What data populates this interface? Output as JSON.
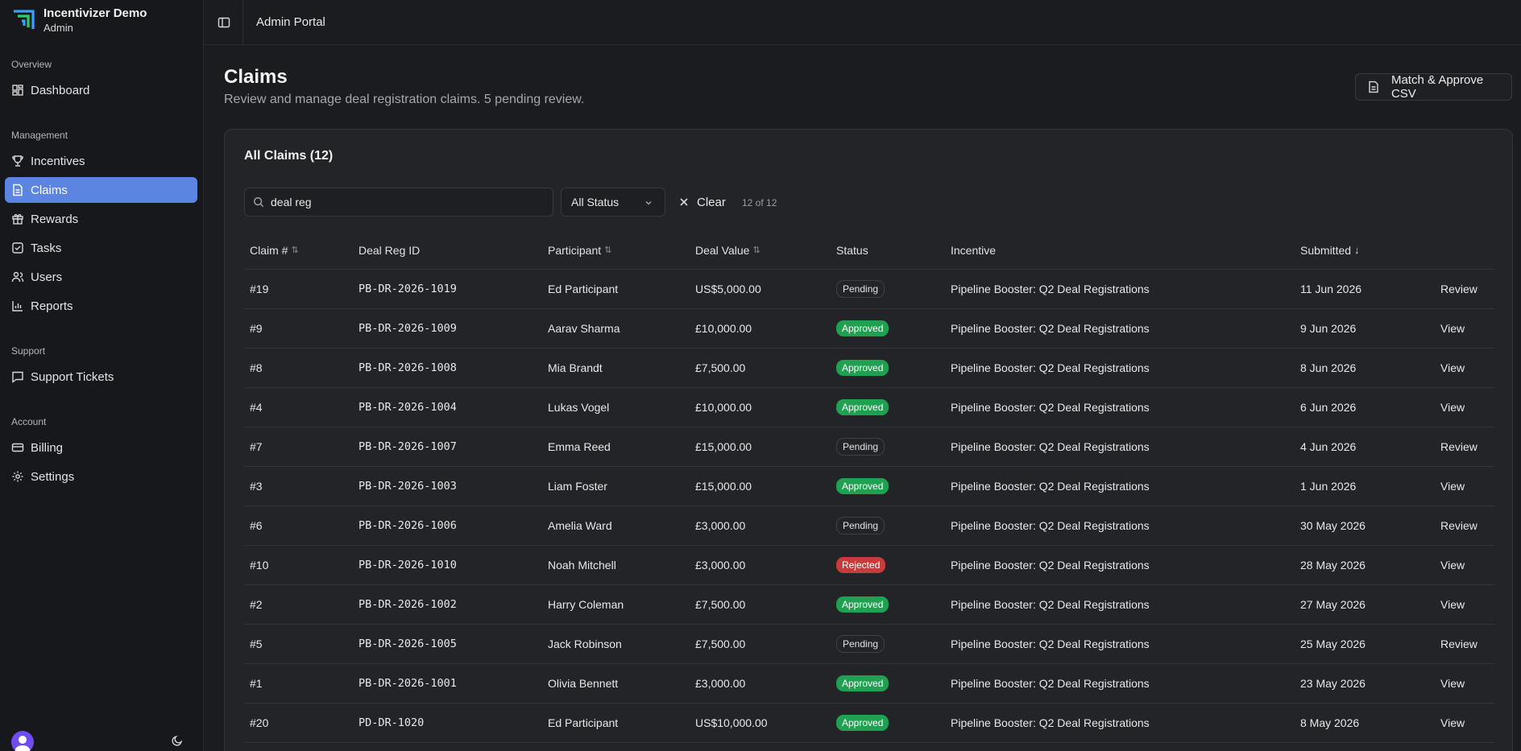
{
  "app": {
    "name": "Incentivizer Demo",
    "role": "Admin"
  },
  "sidebar": {
    "groups": [
      {
        "label": "Overview",
        "items": [
          {
            "label": "Dashboard",
            "icon": "dashboard-icon"
          }
        ]
      },
      {
        "label": "Management",
        "items": [
          {
            "label": "Incentives",
            "icon": "trophy-icon"
          },
          {
            "label": "Claims",
            "icon": "file-icon"
          },
          {
            "label": "Rewards",
            "icon": "gift-icon"
          },
          {
            "label": "Tasks",
            "icon": "checkbox-icon"
          },
          {
            "label": "Users",
            "icon": "users-icon"
          },
          {
            "label": "Reports",
            "icon": "bar-chart-icon"
          }
        ]
      },
      {
        "label": "Support",
        "items": [
          {
            "label": "Support Tickets",
            "icon": "message-icon"
          }
        ]
      },
      {
        "label": "Account",
        "items": [
          {
            "label": "Billing",
            "icon": "credit-card-icon"
          },
          {
            "label": "Settings",
            "icon": "gear-icon"
          }
        ]
      }
    ]
  },
  "topbar": {
    "title": "Admin Portal"
  },
  "page": {
    "title": "Claims",
    "subtitle": "Review and manage deal registration claims. 5 pending review.",
    "action_label": "Match & Approve CSV"
  },
  "card": {
    "title": "All Claims (12)",
    "search_value": "deal reg",
    "status_filter": "All Status",
    "clear_label": "Clear",
    "count_text": "12 of 12"
  },
  "table": {
    "headers": {
      "claim": "Claim #",
      "deal_reg": "Deal Reg ID",
      "participant": "Participant",
      "deal_value": "Deal Value",
      "status": "Status",
      "incentive": "Incentive",
      "submitted": "Submitted"
    },
    "sort_icons": {
      "claim": "⇅",
      "participant": "⇅",
      "deal_value": "⇅",
      "submitted": "↓"
    },
    "rows": [
      {
        "claim": "#19",
        "deal_reg": "PB-DR-2026-1019",
        "participant": "Ed Participant",
        "value": "US$5,000.00",
        "status": "Pending",
        "incentive": "Pipeline Booster: Q2 Deal Registrations",
        "submitted": "11 Jun 2026",
        "action": "Review"
      },
      {
        "claim": "#9",
        "deal_reg": "PB-DR-2026-1009",
        "participant": "Aarav Sharma",
        "value": "£10,000.00",
        "status": "Approved",
        "incentive": "Pipeline Booster: Q2 Deal Registrations",
        "submitted": "9 Jun 2026",
        "action": "View"
      },
      {
        "claim": "#8",
        "deal_reg": "PB-DR-2026-1008",
        "participant": "Mia Brandt",
        "value": "£7,500.00",
        "status": "Approved",
        "incentive": "Pipeline Booster: Q2 Deal Registrations",
        "submitted": "8 Jun 2026",
        "action": "View"
      },
      {
        "claim": "#4",
        "deal_reg": "PB-DR-2026-1004",
        "participant": "Lukas Vogel",
        "value": "£10,000.00",
        "status": "Approved",
        "incentive": "Pipeline Booster: Q2 Deal Registrations",
        "submitted": "6 Jun 2026",
        "action": "View"
      },
      {
        "claim": "#7",
        "deal_reg": "PB-DR-2026-1007",
        "participant": "Emma Reed",
        "value": "£15,000.00",
        "status": "Pending",
        "incentive": "Pipeline Booster: Q2 Deal Registrations",
        "submitted": "4 Jun 2026",
        "action": "Review"
      },
      {
        "claim": "#3",
        "deal_reg": "PB-DR-2026-1003",
        "participant": "Liam Foster",
        "value": "£15,000.00",
        "status": "Approved",
        "incentive": "Pipeline Booster: Q2 Deal Registrations",
        "submitted": "1 Jun 2026",
        "action": "View"
      },
      {
        "claim": "#6",
        "deal_reg": "PB-DR-2026-1006",
        "participant": "Amelia Ward",
        "value": "£3,000.00",
        "status": "Pending",
        "incentive": "Pipeline Booster: Q2 Deal Registrations",
        "submitted": "30 May 2026",
        "action": "Review"
      },
      {
        "claim": "#10",
        "deal_reg": "PB-DR-2026-1010",
        "participant": "Noah Mitchell",
        "value": "£3,000.00",
        "status": "Rejected",
        "incentive": "Pipeline Booster: Q2 Deal Registrations",
        "submitted": "28 May 2026",
        "action": "View"
      },
      {
        "claim": "#2",
        "deal_reg": "PB-DR-2026-1002",
        "participant": "Harry Coleman",
        "value": "£7,500.00",
        "status": "Approved",
        "incentive": "Pipeline Booster: Q2 Deal Registrations",
        "submitted": "27 May 2026",
        "action": "View"
      },
      {
        "claim": "#5",
        "deal_reg": "PB-DR-2026-1005",
        "participant": "Jack Robinson",
        "value": "£7,500.00",
        "status": "Pending",
        "incentive": "Pipeline Booster: Q2 Deal Registrations",
        "submitted": "25 May 2026",
        "action": "Review"
      },
      {
        "claim": "#1",
        "deal_reg": "PB-DR-2026-1001",
        "participant": "Olivia Bennett",
        "value": "£3,000.00",
        "status": "Approved",
        "incentive": "Pipeline Booster: Q2 Deal Registrations",
        "submitted": "23 May 2026",
        "action": "View"
      },
      {
        "claim": "#20",
        "deal_reg": "PD-DR-1020",
        "participant": "Ed Participant",
        "value": "US$10,000.00",
        "status": "Approved",
        "incentive": "Pipeline Booster: Q2 Deal Registrations",
        "submitted": "8 May 2026",
        "action": "View"
      }
    ]
  },
  "colors": {
    "accent": "#5b85e0",
    "approved": "#20a152",
    "rejected": "#c73b3b",
    "background": "#1b1c1f"
  }
}
